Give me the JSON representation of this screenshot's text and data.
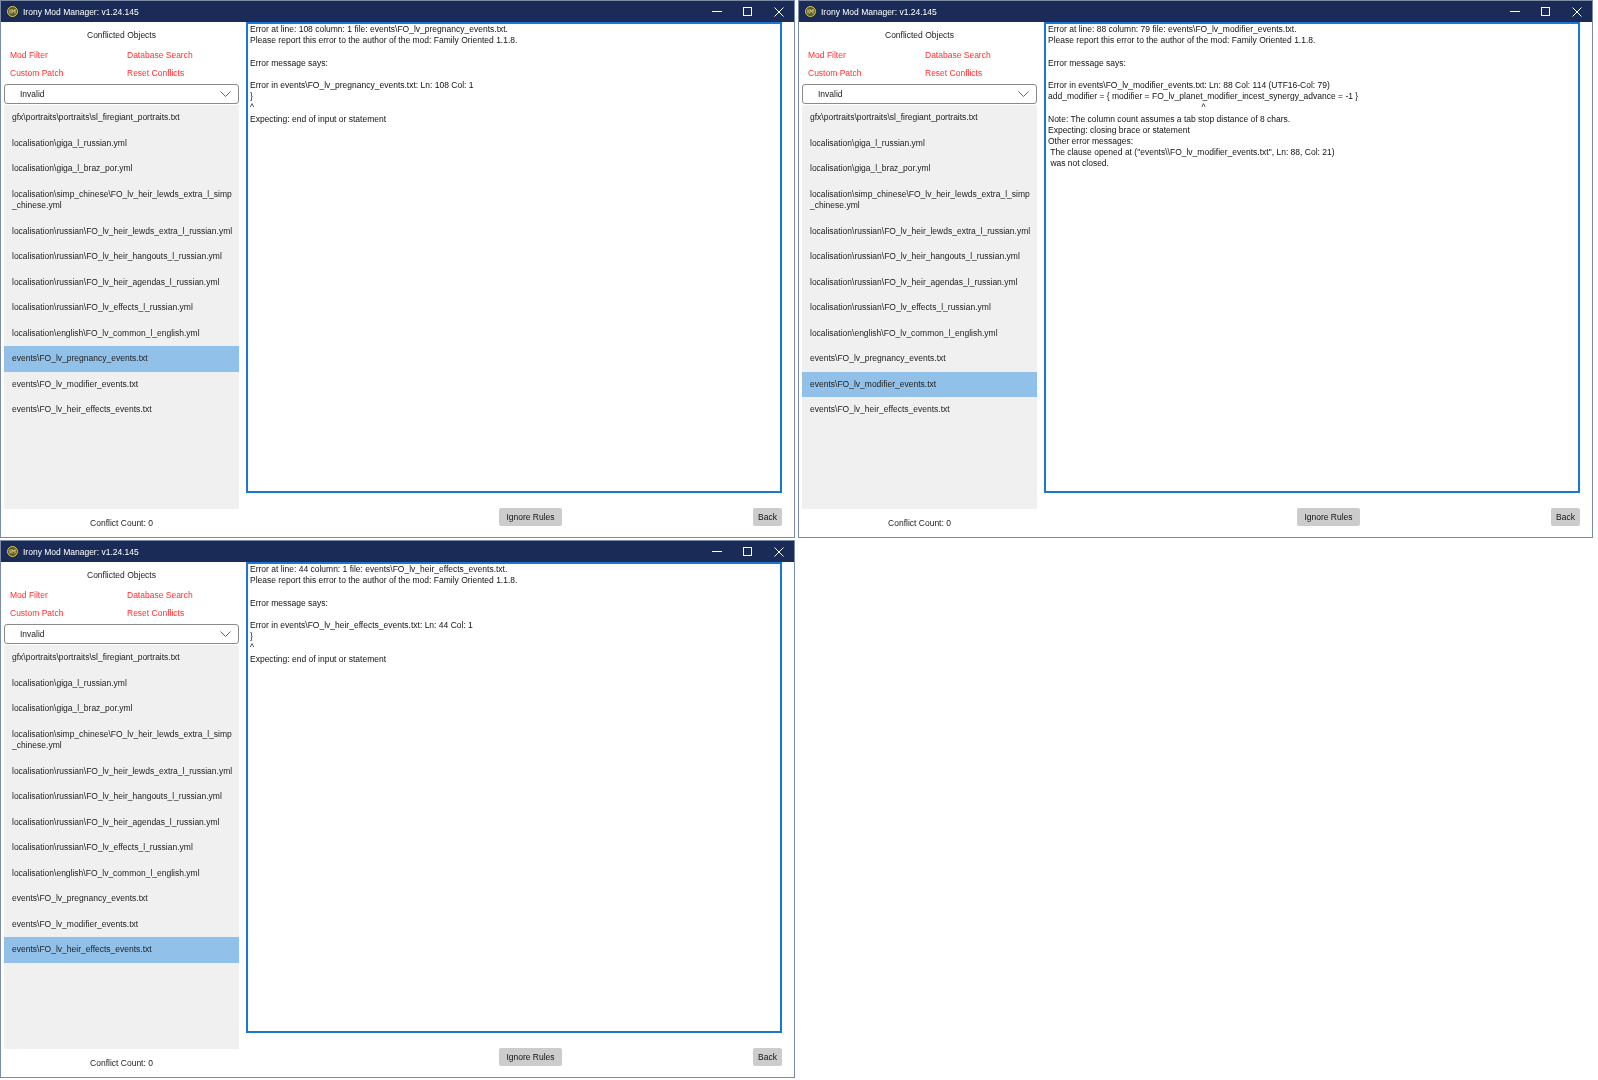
{
  "windows": [
    {
      "title": "Irony Mod Manager: v1.24.145",
      "sidebar": {
        "heading": "Conflicted Objects",
        "links": [
          "Mod Filter",
          "Database Search",
          "Custom Patch",
          "Reset Conflicts"
        ],
        "filter": {
          "value": "Invalid"
        },
        "items": [
          {
            "label": "gfx\\portraits\\portraits\\sl_firegiant_portraits.txt",
            "selected": false
          },
          {
            "label": "localisation\\giga_l_russian.yml",
            "selected": false
          },
          {
            "label": "localisation\\giga_l_braz_por.yml",
            "selected": false
          },
          {
            "label": "localisation\\simp_chinese\\FO_lv_heir_lewds_extra_l_simp_chinese.yml",
            "selected": false
          },
          {
            "label": "localisation\\russian\\FO_lv_heir_lewds_extra_l_russian.yml",
            "selected": false
          },
          {
            "label": "localisation\\russian\\FO_lv_heir_hangouts_l_russian.yml",
            "selected": false
          },
          {
            "label": "localisation\\russian\\FO_lv_heir_agendas_l_russian.yml",
            "selected": false
          },
          {
            "label": "localisation\\russian\\FO_lv_effects_l_russian.yml",
            "selected": false
          },
          {
            "label": "localisation\\english\\FO_lv_common_l_english.yml",
            "selected": false
          },
          {
            "label": "events\\FO_lv_pregnancy_events.txt",
            "selected": true
          },
          {
            "label": "events\\FO_lv_modifier_events.txt",
            "selected": false
          },
          {
            "label": "events\\FO_lv_heir_effects_events.txt",
            "selected": false
          }
        ],
        "conflict_count": "Conflict Count: 0"
      },
      "error_text": {
        "paragraphs": [
          [
            "Error at line: 108 column: 1 file: events\\FO_lv_pregnancy_events.txt.",
            "Please report this error to the author of the mod: Family Oriented 1.1.8."
          ],
          [
            "Error message says:"
          ],
          [
            "Error in events\\FO_lv_pregnancy_events.txt: Ln: 108 Col: 1",
            "}",
            "^",
            "Expecting: end of input or statement"
          ]
        ]
      },
      "buttons": [
        "Ignore Rules",
        "Back"
      ]
    },
    {
      "title": "Irony Mod Manager: v1.24.145",
      "sidebar": {
        "heading": "Conflicted Objects",
        "links": [
          "Mod Filter",
          "Database Search",
          "Custom Patch",
          "Reset Conflicts"
        ],
        "filter": {
          "value": "Invalid"
        },
        "items": [
          {
            "label": "gfx\\portraits\\portraits\\sl_firegiant_portraits.txt",
            "selected": false
          },
          {
            "label": "localisation\\giga_l_russian.yml",
            "selected": false
          },
          {
            "label": "localisation\\giga_l_braz_por.yml",
            "selected": false
          },
          {
            "label": "localisation\\simp_chinese\\FO_lv_heir_lewds_extra_l_simp_chinese.yml",
            "selected": false
          },
          {
            "label": "localisation\\russian\\FO_lv_heir_lewds_extra_l_russian.yml",
            "selected": false
          },
          {
            "label": "localisation\\russian\\FO_lv_heir_hangouts_l_russian.yml",
            "selected": false
          },
          {
            "label": "localisation\\russian\\FO_lv_heir_agendas_l_russian.yml",
            "selected": false
          },
          {
            "label": "localisation\\russian\\FO_lv_effects_l_russian.yml",
            "selected": false
          },
          {
            "label": "localisation\\english\\FO_lv_common_l_english.yml",
            "selected": false
          },
          {
            "label": "events\\FO_lv_pregnancy_events.txt",
            "selected": false
          },
          {
            "label": "events\\FO_lv_modifier_events.txt",
            "selected": true
          },
          {
            "label": "events\\FO_lv_heir_effects_events.txt",
            "selected": false
          }
        ],
        "conflict_count": "Conflict Count: 0"
      },
      "error_text": {
        "paragraphs": [
          [
            "Error at line: 88 column: 79 file: events\\FO_lv_modifier_events.txt.",
            "Please report this error to the author of the mod: Family Oriented 1.1.8."
          ],
          [
            "Error message says:"
          ],
          [
            "Error in events\\FO_lv_modifier_events.txt: Ln: 88 Col: 114 (UTF16-Col: 79)",
            "add_modifier = { modifier = FO_lv_planet_modifier_incest_synergy_advance = -1 }",
            "                                                                 ^",
            "Note: The column count assumes a tab stop distance of 8 chars.",
            "Expecting: closing brace or statement",
            "Other error messages:",
            " The clause opened at (\"events\\\\FO_lv_modifier_events.txt\", Ln: 88, Col: 21)",
            " was not closed."
          ]
        ]
      },
      "buttons": [
        "Ignore Rules",
        "Back"
      ]
    },
    {
      "title": "Irony Mod Manager: v1.24.145",
      "sidebar": {
        "heading": "Conflicted Objects",
        "links": [
          "Mod Filter",
          "Database Search",
          "Custom Patch",
          "Reset Conflicts"
        ],
        "filter": {
          "value": "Invalid"
        },
        "items": [
          {
            "label": "gfx\\portraits\\portraits\\sl_firegiant_portraits.txt",
            "selected": false
          },
          {
            "label": "localisation\\giga_l_russian.yml",
            "selected": false
          },
          {
            "label": "localisation\\giga_l_braz_por.yml",
            "selected": false
          },
          {
            "label": "localisation\\simp_chinese\\FO_lv_heir_lewds_extra_l_simp_chinese.yml",
            "selected": false
          },
          {
            "label": "localisation\\russian\\FO_lv_heir_lewds_extra_l_russian.yml",
            "selected": false
          },
          {
            "label": "localisation\\russian\\FO_lv_heir_hangouts_l_russian.yml",
            "selected": false
          },
          {
            "label": "localisation\\russian\\FO_lv_heir_agendas_l_russian.yml",
            "selected": false
          },
          {
            "label": "localisation\\russian\\FO_lv_effects_l_russian.yml",
            "selected": false
          },
          {
            "label": "localisation\\english\\FO_lv_common_l_english.yml",
            "selected": false
          },
          {
            "label": "events\\FO_lv_pregnancy_events.txt",
            "selected": false
          },
          {
            "label": "events\\FO_lv_modifier_events.txt",
            "selected": false
          },
          {
            "label": "events\\FO_lv_heir_effects_events.txt",
            "selected": true
          }
        ],
        "conflict_count": "Conflict Count: 0"
      },
      "error_text": {
        "paragraphs": [
          [
            "Error at line: 44 column: 1 file: events\\FO_lv_heir_effects_events.txt.",
            "Please report this error to the author of the mod: Family Oriented 1.1.8."
          ],
          [
            "Error message says:"
          ],
          [
            "Error in events\\FO_lv_heir_effects_events.txt: Ln: 44 Col: 1",
            "}",
            "^",
            "Expecting: end of input or statement"
          ]
        ]
      },
      "buttons": [
        "Ignore Rules",
        "Back"
      ]
    }
  ]
}
